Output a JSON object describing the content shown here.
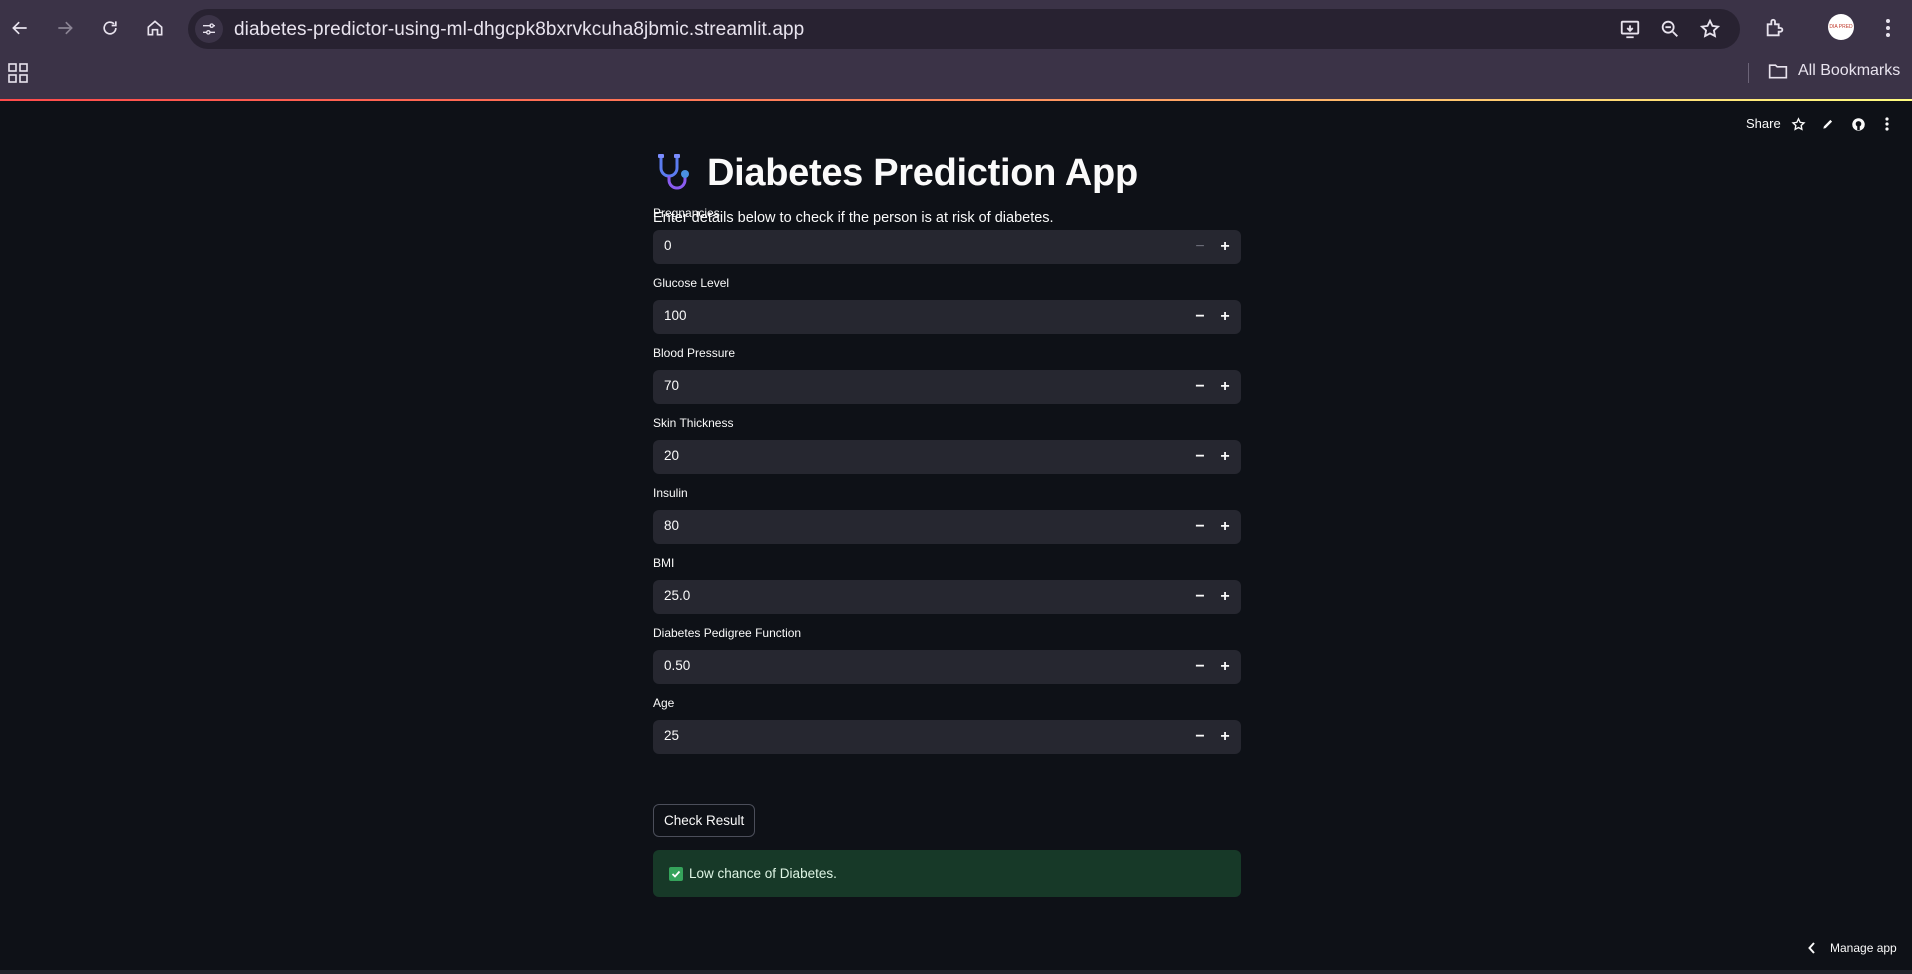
{
  "browser": {
    "url": "diabetes-predictor-using-ml-dhgcpk8bxrvkcuha8jbmic.streamlit.app",
    "bookmarks_label": "All Bookmarks",
    "profile_text": "DIA PRED",
    "icons": [
      "back-icon",
      "forward-icon",
      "reload-icon",
      "home-icon",
      "site-settings-icon",
      "install-app-icon",
      "zoom-icon",
      "bookmark-star-icon",
      "extensions-icon",
      "menu-icon",
      "apps-grid-icon",
      "folder-icon"
    ]
  },
  "streamlit_toolbar": {
    "share_label": "Share"
  },
  "app": {
    "title": "Diabetes Prediction App",
    "title_emoji": "stethoscope-icon",
    "subtitle": "Enter details below to check if the person is at risk of diabetes.",
    "fields": [
      {
        "label": "Pregnancies",
        "value": "0"
      },
      {
        "label": "Glucose Level",
        "value": "100"
      },
      {
        "label": "Blood Pressure",
        "value": "70"
      },
      {
        "label": "Skin Thickness",
        "value": "20"
      },
      {
        "label": "Insulin",
        "value": "80"
      },
      {
        "label": "BMI",
        "value": "25.0"
      },
      {
        "label": "Diabetes Pedigree Function",
        "value": "0.50"
      },
      {
        "label": "Age",
        "value": "25"
      }
    ],
    "minus_symbol": "−",
    "plus_symbol": "+",
    "button_label": "Check Result",
    "result_text": "Low chance of Diabetes.",
    "result_color": "#173928"
  },
  "footer": {
    "manage_label": "Manage app"
  },
  "colors": {
    "background": "#0e1117",
    "input_bg": "#262730",
    "chrome_bg": "#3b3347"
  }
}
